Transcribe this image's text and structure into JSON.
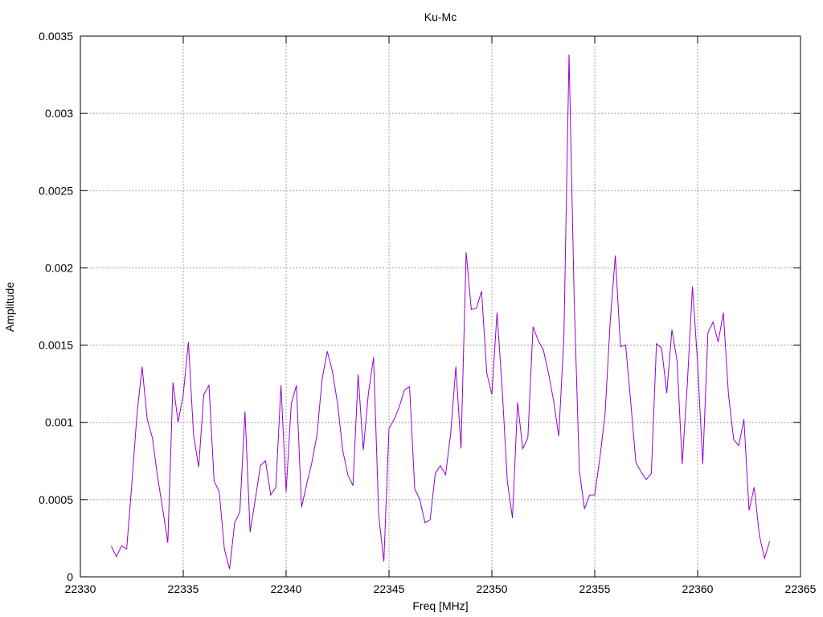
{
  "chart_data": {
    "type": "line",
    "title": "Ku-Mc",
    "xlabel": "Freq [MHz]",
    "ylabel": "Amplitude",
    "xlim": [
      22330,
      22365
    ],
    "ylim": [
      0,
      0.0035
    ],
    "x_ticks": [
      "22330",
      "22335",
      "22340",
      "22345",
      "22350",
      "22355",
      "22360",
      "22365"
    ],
    "y_ticks": [
      "0",
      "0.0005",
      "0.001",
      "0.0015",
      "0.002",
      "0.0025",
      "0.003",
      "0.0035"
    ],
    "grid": true,
    "legend": "none",
    "line_color": "#9400d3",
    "series": [
      {
        "x": [
          22331.5,
          22331.75,
          22332,
          22332.25,
          22332.5,
          22332.75,
          22333,
          22333.25,
          22333.5,
          22333.75,
          22334,
          22334.25,
          22334.5,
          22334.75,
          22335,
          22335.25,
          22335.5,
          22335.75,
          22336,
          22336.25,
          22336.5,
          22336.75,
          22337,
          22337.25,
          22337.5,
          22337.75,
          22338,
          22338.25,
          22338.5,
          22338.75,
          22339,
          22339.25,
          22339.5,
          22339.75,
          22340,
          22340.25,
          22340.5,
          22340.75,
          22341,
          22341.25,
          22341.5,
          22341.75,
          22342,
          22342.25,
          22342.5,
          22342.75,
          22343,
          22343.25,
          22343.5,
          22343.75,
          22344,
          22344.25,
          22344.5,
          22344.75,
          22345,
          22345.25,
          22345.5,
          22345.75,
          22346,
          22346.25,
          22346.5,
          22346.75,
          22347,
          22347.25,
          22347.5,
          22347.75,
          22348,
          22348.25,
          22348.5,
          22348.75,
          22349,
          22349.25,
          22349.5,
          22349.75,
          22350,
          22350.25,
          22350.5,
          22350.75,
          22351,
          22351.25,
          22351.5,
          22351.75,
          22352,
          22352.25,
          22352.5,
          22352.75,
          22353,
          22353.25,
          22353.5,
          22353.75,
          22354,
          22354.25,
          22354.5,
          22354.75,
          22355,
          22355.25,
          22355.5,
          22355.75,
          22356,
          22356.25,
          22356.5,
          22356.75,
          22357,
          22357.25,
          22357.5,
          22357.75,
          22358,
          22358.25,
          22358.5,
          22358.75,
          22359,
          22359.25,
          22359.5,
          22359.75,
          22360,
          22360.25,
          22360.5,
          22360.75,
          22361,
          22361.25,
          22361.5,
          22361.75,
          22362,
          22362.25,
          22362.5,
          22362.75,
          22363,
          22363.25,
          22363.5
        ],
        "values": [
          0.0002,
          0.00013,
          0.0002,
          0.00018,
          0.0006,
          0.00105,
          0.00136,
          0.00102,
          0.0009,
          0.00065,
          0.00044,
          0.00022,
          0.00126,
          0.001,
          0.00118,
          0.00152,
          0.00092,
          0.00071,
          0.00118,
          0.00124,
          0.00062,
          0.00055,
          0.00018,
          5e-05,
          0.00035,
          0.00042,
          0.00107,
          0.00029,
          0.0005,
          0.00072,
          0.00075,
          0.00053,
          0.00058,
          0.00124,
          0.00055,
          0.00112,
          0.00124,
          0.00045,
          0.0006,
          0.00074,
          0.00092,
          0.00128,
          0.00146,
          0.00133,
          0.00112,
          0.00082,
          0.00066,
          0.00059,
          0.00131,
          0.00082,
          0.00119,
          0.00142,
          0.0004,
          0.0001,
          0.00096,
          0.00102,
          0.0011,
          0.00121,
          0.00123,
          0.00057,
          0.0005,
          0.00035,
          0.00037,
          0.00067,
          0.00072,
          0.00066,
          0.00093,
          0.00136,
          0.00083,
          0.0021,
          0.00173,
          0.00174,
          0.00185,
          0.00132,
          0.00118,
          0.00171,
          0.00122,
          0.00062,
          0.00038,
          0.00113,
          0.00083,
          0.0009,
          0.00162,
          0.00153,
          0.00147,
          0.00132,
          0.00114,
          0.00091,
          0.00155,
          0.00338,
          0.0018,
          0.00069,
          0.00044,
          0.00053,
          0.00053,
          0.00077,
          0.00105,
          0.00165,
          0.00208,
          0.00149,
          0.0015,
          0.00113,
          0.00074,
          0.00068,
          0.00063,
          0.00067,
          0.00151,
          0.00148,
          0.00119,
          0.0016,
          0.0014,
          0.00073,
          0.00125,
          0.00188,
          0.00138,
          0.00073,
          0.00158,
          0.00165,
          0.00152,
          0.00171,
          0.00118,
          0.00089,
          0.00085,
          0.00102,
          0.00043,
          0.00058,
          0.00027,
          0.00012,
          0.00023
        ]
      }
    ]
  }
}
